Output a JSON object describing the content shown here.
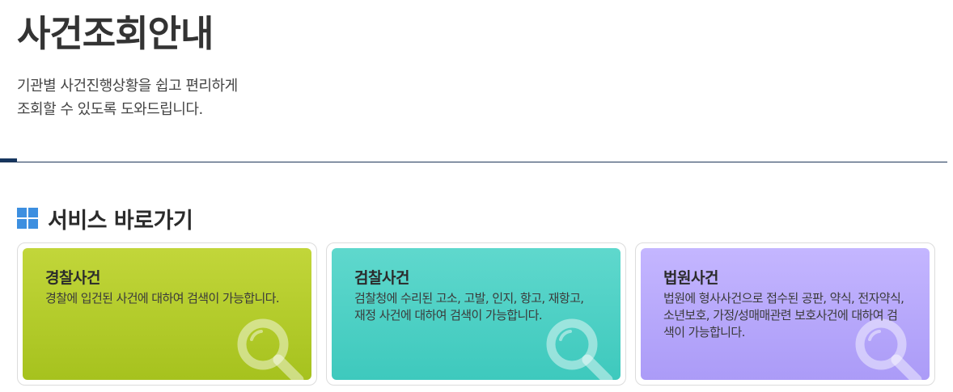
{
  "header": {
    "title": "사건조회안내",
    "desc_line1": "기관별 사건진행상황을 쉽고 편리하게",
    "desc_line2": "조회할 수 있도록 도와드립니다."
  },
  "section": {
    "title": "서비스 바로가기",
    "icon": "grid-icon"
  },
  "cards": [
    {
      "title": "경찰사건",
      "desc": "경찰에 입건된 사건에 대하여 검색이 가능합니다.",
      "icon": "magnifier-icon",
      "color": "#b4cc2a"
    },
    {
      "title": "검찰사건",
      "desc": "검찰청에 수리된 고소, 고발, 인지, 항고, 재항고, 재정 사건에 대하여 검색이 가능합니다.",
      "icon": "magnifier-icon",
      "color": "#4ed0c4"
    },
    {
      "title": "법원사건",
      "desc": "법원에 형사사건으로 접수된 공판, 약식, 전자약식, 소년보호, 가정/성매매관련 보호사건에 대하여 검색이 가능합니다.",
      "icon": "magnifier-icon",
      "color": "#b8a9fb"
    }
  ],
  "colors": {
    "accent_navy": "#16365f",
    "section_icon_blue": "#3d8fe0"
  }
}
